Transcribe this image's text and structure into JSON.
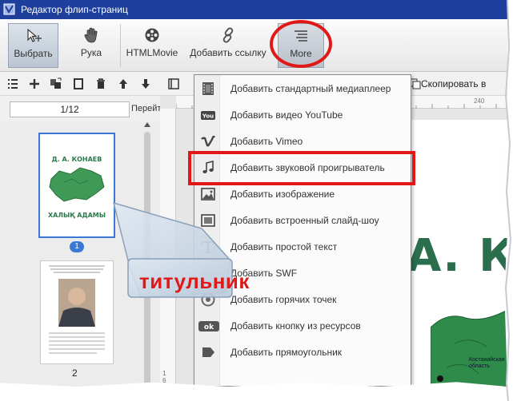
{
  "window": {
    "title": "Редактор флип-страниц"
  },
  "ribbon": {
    "select_label": "Выбрать",
    "hand_label": "Рука",
    "htmlmovie_label": "HTMLMovie",
    "add_link_label": "Добавить ссылку",
    "more_label": "More"
  },
  "pages": {
    "page_indicator": "1/12",
    "go_label": "Перейти",
    "thumb1_number": "1",
    "thumb2_number": "2",
    "thumb1_top_text": "Д. А. КОНАЕВ",
    "thumb1_bottom_text": "ХАЛЫҚ АДАМЫ"
  },
  "editor": {
    "copy_label": "Скопировать в",
    "ruler_mark": "240",
    "ruler_left_1": "160",
    "ruler_left_2": "240",
    "page_title_fragment": "А. КО",
    "map_label": "Костанайская область"
  },
  "menu": {
    "items": [
      {
        "label": "Добавить стандартный  медиаплеер",
        "icon": "film-icon"
      },
      {
        "label": "Добавить видео YouTube",
        "icon": "youtube-icon"
      },
      {
        "label": "Добавить Vimeo",
        "icon": "vimeo-icon"
      },
      {
        "label": "Добавить звуковой проигрыватель",
        "icon": "music-note-icon"
      },
      {
        "label": "Добавить изображение",
        "icon": "image-icon"
      },
      {
        "label": "Добавить встроенный слайд-шоу",
        "icon": "slideshow-icon"
      },
      {
        "label": "Добавить простой текст",
        "icon": "text-icon"
      },
      {
        "label": "Добавить SWF",
        "icon": "swf-icon"
      },
      {
        "label": "Добавить горячих точек",
        "icon": "hotspot-icon"
      },
      {
        "label": "Добавить кнопку из ресурсов",
        "icon": "ok-button-icon",
        "icon_text": "ok"
      },
      {
        "label": "Добавить прямоугольник",
        "icon": "shape-icon"
      }
    ]
  },
  "annotation": {
    "callout_text": "титульник"
  },
  "colors": {
    "titlebar": "#1e3f9b",
    "highlight_red": "#e01818",
    "selection_blue": "#3a78d6",
    "map_green": "#2f8b4a"
  }
}
